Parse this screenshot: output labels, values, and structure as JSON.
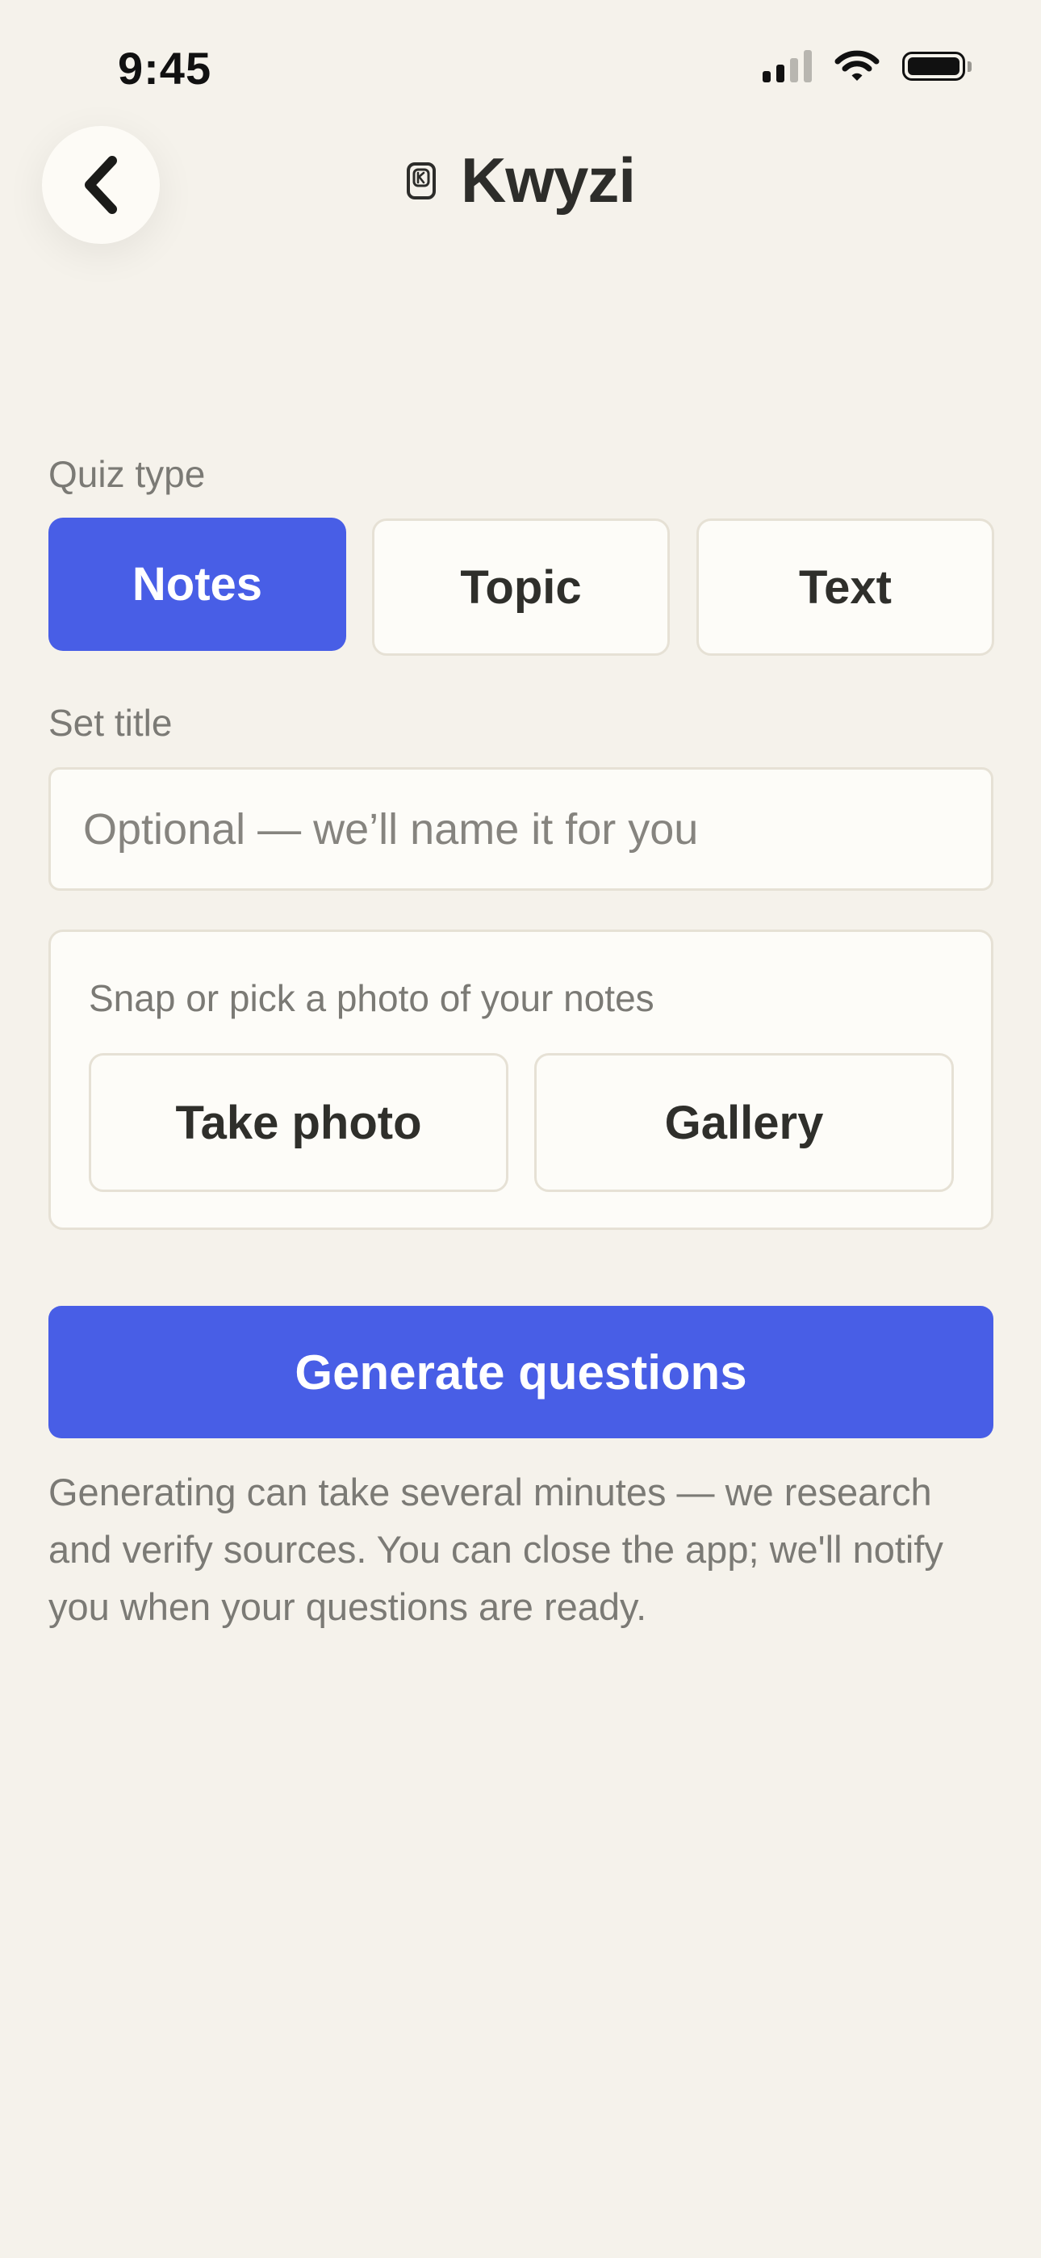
{
  "status_bar": {
    "time": "9:45",
    "icons": [
      "signal-icon",
      "wifi-icon",
      "battery-icon"
    ]
  },
  "header": {
    "back_icon": "chevron-left-icon",
    "logo_icon": "kwyzi-logo-icon",
    "app_name": "Kwyzi"
  },
  "quiz_type": {
    "label": "Quiz type",
    "options": [
      {
        "label": "Notes",
        "selected": true
      },
      {
        "label": "Topic",
        "selected": false
      },
      {
        "label": "Text",
        "selected": false
      }
    ]
  },
  "title": {
    "label": "Set title",
    "value": "",
    "placeholder": "Optional — we’ll name it for you"
  },
  "photo": {
    "caption": "Snap or pick a photo of your notes",
    "take_photo_label": "Take photo",
    "gallery_label": "Gallery"
  },
  "generate": {
    "button_label": "Generate questions",
    "helper_text": "Generating can take several minutes — we research and verify sources. You can close the app; we'll notify you when your questions are ready."
  },
  "colors": {
    "background": "#f5f2eb",
    "accent": "#485ee6",
    "card": "#fdfcf8",
    "border": "#e6e1d5",
    "text_primary": "#2f2f2b",
    "text_secondary": "#7b7a75"
  }
}
